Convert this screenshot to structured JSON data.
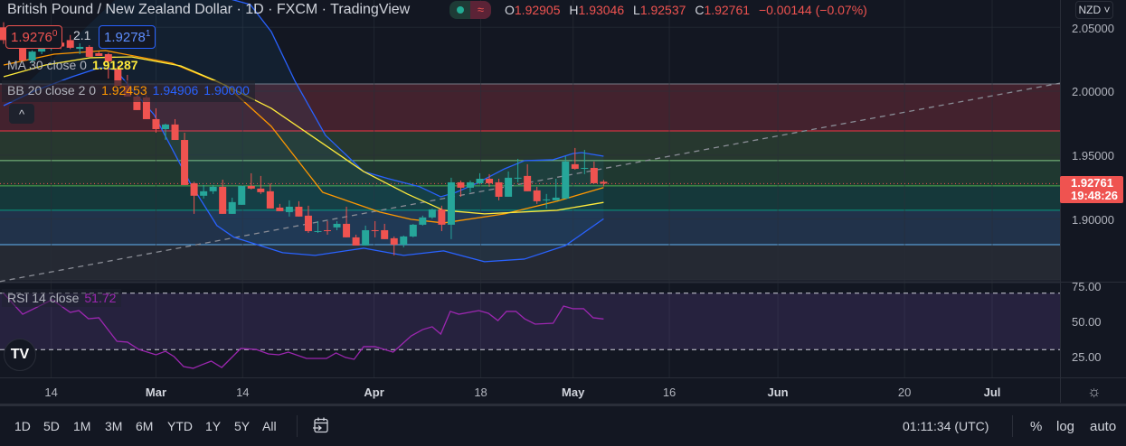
{
  "header": {
    "title": "British Pound / New Zealand Dollar · 1D · FXCM · TradingView",
    "status_symbol": "≈",
    "ohlc": {
      "o_label": "O",
      "o": "1.92905",
      "h_label": "H",
      "h": "1.93046",
      "l_label": "L",
      "l": "1.92537",
      "c_label": "C",
      "c": "1.92761",
      "change": "−0.00144 (−0.07%)"
    }
  },
  "trade": {
    "sell": "1.9276",
    "sell_sup": "0",
    "spread": "2.1",
    "buy": "1.9278",
    "buy_sup": "1"
  },
  "legends": {
    "ma": {
      "name": "MA 30 close 0",
      "value": "1.91287"
    },
    "bb": {
      "name": "BB 20 close 2 0",
      "basis": "1.92453",
      "upper": "1.94906",
      "lower": "1.90000"
    },
    "rsi": {
      "name": "RSI 14 close",
      "value": "51.72"
    }
  },
  "collapse_icon": "^",
  "logo_text": "TV",
  "price_axis": {
    "currency": "NZD",
    "ticks": [
      "2.05000",
      "2.00000",
      "1.95000",
      "1.90000"
    ],
    "rsi_ticks": [
      "75.00",
      "50.00",
      "25.00"
    ],
    "last_price": "1.92761",
    "countdown": "19:48:26"
  },
  "bottom_bar": {
    "periods": [
      "1D",
      "5D",
      "1M",
      "3M",
      "6M",
      "YTD",
      "1Y",
      "5Y",
      "All"
    ],
    "clock": "01:11:34 (UTC)",
    "percent": "%",
    "log": "log",
    "auto": "auto"
  },
  "colors": {
    "up": "#26a69a",
    "down": "#ef5350",
    "ma": "#ffeb3b",
    "bb_basis": "#ff9800",
    "bb_band": "#2962ff",
    "rsi": "#9c27b0",
    "background": "#131722"
  },
  "chart_data": {
    "type": "candlestick",
    "title": "British Pound / New Zealand Dollar · 1D · FXCM",
    "ylim": [
      1.848,
      2.07
    ],
    "yticks": [
      2.05,
      2.0,
      1.95,
      1.9
    ],
    "x_ticks": [
      {
        "label": "14",
        "bar": 5.0,
        "month": false
      },
      {
        "label": "Mar",
        "bar": 16.0,
        "month": true
      },
      {
        "label": "14",
        "bar": 25.1,
        "month": false
      },
      {
        "label": "Apr",
        "bar": 38.9,
        "month": true
      },
      {
        "label": "18",
        "bar": 50.1,
        "month": false
      },
      {
        "label": "May",
        "bar": 59.8,
        "month": true
      },
      {
        "label": "16",
        "bar": 69.9,
        "month": false
      },
      {
        "label": "Jun",
        "bar": 81.3,
        "month": true
      },
      {
        "label": "20",
        "bar": 94.6,
        "month": false
      },
      {
        "label": "Jul",
        "bar": 103.8,
        "month": true
      }
    ],
    "candles_ohlc": [
      [
        2.05,
        2.054,
        2.037,
        2.04
      ],
      [
        2.037,
        2.043,
        2.035,
        2.041
      ],
      [
        2.034,
        2.036,
        2.024,
        2.024
      ],
      [
        2.024,
        2.032,
        2.022,
        2.031
      ],
      [
        2.031,
        2.035,
        2.029,
        2.034
      ],
      [
        2.034,
        2.04,
        2.032,
        2.038
      ],
      [
        2.038,
        2.041,
        2.033,
        2.035
      ],
      [
        2.04,
        2.044,
        2.033,
        2.034
      ],
      [
        2.0332,
        2.0375,
        2.029,
        2.0347
      ],
      [
        2.0347,
        2.036,
        2.0269,
        2.0269
      ],
      [
        2.0297,
        2.031,
        2.0276,
        2.0276
      ],
      [
        2.029,
        2.03,
        2.0099,
        2.0234
      ],
      [
        2.017,
        2.02,
        2.0043,
        2.0043
      ],
      [
        2.0043,
        2.0128,
        1.9958,
        1.9958
      ],
      [
        1.9958,
        1.997,
        1.9852,
        1.9852
      ],
      [
        1.9951,
        1.997,
        1.9781,
        1.9781
      ],
      [
        1.9781,
        1.9866,
        1.9675,
        1.9703
      ],
      [
        1.9703,
        1.9746,
        1.9618,
        1.9739
      ],
      [
        1.9739,
        1.9781,
        1.9618,
        1.9618
      ],
      [
        1.9618,
        1.9675,
        1.9265,
        1.9265
      ],
      [
        1.9279,
        1.929,
        1.9039,
        1.9181
      ],
      [
        1.9181,
        1.9265,
        1.9159,
        1.9216
      ],
      [
        1.9216,
        1.9265,
        1.9195,
        1.9251
      ],
      [
        1.9251,
        1.9307,
        1.9039,
        1.9039
      ],
      [
        1.9039,
        1.9166,
        1.9039,
        1.9131
      ],
      [
        1.911,
        1.9258,
        1.911,
        1.9258
      ],
      [
        1.9258,
        1.9357,
        1.923,
        1.9237
      ],
      [
        1.9237,
        1.9336,
        1.9195,
        1.9209
      ],
      [
        1.9216,
        1.9279,
        1.9081,
        1.9081
      ],
      [
        1.9088,
        1.9117,
        1.906,
        1.906
      ],
      [
        1.9053,
        1.9145,
        1.9018,
        1.9095
      ],
      [
        1.9095,
        1.9138,
        1.9018,
        1.9018
      ],
      [
        1.9025,
        1.9103,
        1.889,
        1.8904
      ],
      [
        1.8897,
        1.8982,
        1.889,
        1.8904
      ],
      [
        1.8911,
        1.8982,
        1.8876,
        1.8904
      ],
      [
        1.8933,
        1.8982,
        1.8911,
        1.8961
      ],
      [
        1.8961,
        1.9095,
        1.8855,
        1.8855
      ],
      [
        1.8855,
        1.8876,
        1.8791,
        1.8791
      ],
      [
        1.8791,
        1.8947,
        1.8791,
        1.8911
      ],
      [
        1.8911,
        1.8982,
        1.8855,
        1.8904
      ],
      [
        1.8911,
        1.8961,
        1.8841,
        1.8841
      ],
      [
        1.8848,
        1.8862,
        1.8714,
        1.8798
      ],
      [
        1.8798,
        1.8869,
        1.8777,
        1.8862
      ],
      [
        1.8862,
        1.896,
        1.8855,
        1.8954
      ],
      [
        1.8954,
        1.9025,
        1.8947,
        1.9011
      ],
      [
        1.9011,
        1.908,
        1.9,
        1.9074
      ],
      [
        1.9074,
        1.9103,
        1.8904,
        1.8954
      ],
      [
        1.8954,
        1.9322,
        1.8841,
        1.9286
      ],
      [
        1.9286,
        1.93,
        1.9173,
        1.9244
      ],
      [
        1.9244,
        1.93,
        1.9209,
        1.9286
      ],
      [
        1.9279,
        1.9357,
        1.927,
        1.9314
      ],
      [
        1.9314,
        1.935,
        1.9251,
        1.9279
      ],
      [
        1.9286,
        1.9314,
        1.9145,
        1.9173
      ],
      [
        1.9173,
        1.9371,
        1.9173,
        1.9322
      ],
      [
        1.9318,
        1.947,
        1.9286,
        1.9322
      ],
      [
        1.9336,
        1.9428,
        1.9216,
        1.9216
      ],
      [
        1.9223,
        1.9251,
        1.9117,
        1.9138
      ],
      [
        1.9145,
        1.9195,
        1.9081,
        1.9152
      ],
      [
        1.9145,
        1.9314,
        1.9145,
        1.9166
      ],
      [
        1.9159,
        1.9491,
        1.9159,
        1.9449
      ],
      [
        1.9428,
        1.9555,
        1.9385,
        1.9392
      ],
      [
        1.9392,
        1.954,
        1.935,
        1.9399
      ],
      [
        1.9399,
        1.9449,
        1.9279,
        1.9279
      ],
      [
        1.92905,
        1.93046,
        1.92537,
        1.92761
      ]
    ],
    "ma30": [
      [
        0,
        2.0113
      ],
      [
        4.4,
        2.0205
      ],
      [
        9.1,
        2.0262
      ],
      [
        13.4,
        2.0269
      ],
      [
        18.6,
        2.0198
      ],
      [
        22.4,
        2.0078
      ],
      [
        28.1,
        1.9866
      ],
      [
        37.8,
        1.9371
      ],
      [
        42.4,
        1.9194
      ],
      [
        46.2,
        1.9067
      ],
      [
        50.5,
        1.9039
      ],
      [
        58.1,
        1.9067
      ],
      [
        63,
        1.91287
      ]
    ],
    "bb_basis": [
      [
        0,
        2.0205
      ],
      [
        5.3,
        2.029
      ],
      [
        10.7,
        2.0318
      ],
      [
        17.7,
        2.0219
      ],
      [
        23.4,
        2.0043
      ],
      [
        28.1,
        1.9725
      ],
      [
        33.5,
        1.9208
      ],
      [
        39.5,
        1.9053
      ],
      [
        42.8,
        1.8996
      ],
      [
        46.2,
        1.8968
      ],
      [
        52.6,
        1.9039
      ],
      [
        58.1,
        1.9138
      ],
      [
        63,
        1.92453
      ]
    ],
    "bb_upper": [
      [
        15,
        2.095
      ],
      [
        22.4,
        2.075
      ],
      [
        25.9,
        2.0679
      ],
      [
        28.1,
        2.0467
      ],
      [
        30.6,
        2.0078
      ],
      [
        33.8,
        1.9654
      ],
      [
        37.8,
        1.9371
      ],
      [
        40.4,
        1.9315
      ],
      [
        43.7,
        1.9251
      ],
      [
        45.9,
        1.9173
      ],
      [
        47.5,
        1.9208
      ],
      [
        49.7,
        1.9279
      ],
      [
        52.6,
        1.9392
      ],
      [
        54.7,
        1.9456
      ],
      [
        57.7,
        1.9463
      ],
      [
        59.8,
        1.9512
      ],
      [
        60.7,
        1.9519
      ],
      [
        63,
        1.94906
      ]
    ],
    "bb_lower": [
      [
        0,
        1.9887
      ],
      [
        3.4,
        2.0007
      ],
      [
        7.2,
        2.0113
      ],
      [
        10.1,
        2.0184
      ],
      [
        11.7,
        2.017
      ],
      [
        15.8,
        1.9816
      ],
      [
        19.6,
        1.9279
      ],
      [
        22.4,
        1.8947
      ],
      [
        24.2,
        1.8855
      ],
      [
        29.3,
        1.8735
      ],
      [
        32.7,
        1.8714
      ],
      [
        37.8,
        1.877
      ],
      [
        42,
        1.8714
      ],
      [
        46.2,
        1.8749
      ],
      [
        50.5,
        1.8664
      ],
      [
        54.7,
        1.8685
      ],
      [
        59,
        1.8791
      ],
      [
        63,
        1.9
      ]
    ],
    "zones": [
      {
        "from": 2.0057,
        "to": 1.9689,
        "fill": "#43222e",
        "line": "#787b86"
      },
      {
        "from": 1.9689,
        "to": 1.9456,
        "fill": "#27382f",
        "line": "#f23645"
      },
      {
        "from": 1.9456,
        "to": 1.9258,
        "fill": "#1f3830",
        "line": "#81c784"
      },
      {
        "from": 1.9258,
        "to": 1.9067,
        "fill": "#15383a",
        "line": "#4caf50"
      },
      {
        "from": 1.9067,
        "to": 1.8798,
        "fill": "#21324a",
        "line": "#089981"
      },
      {
        "from": 1.8798,
        "to": 1.8522,
        "fill": "#252933",
        "line": "#64b5f6"
      }
    ],
    "trendline": [
      [
        -0.4,
        1.8509
      ],
      [
        111,
        2.0064
      ]
    ],
    "rsi": {
      "ylim": [
        0,
        100
      ],
      "upper_band": 70,
      "lower_band": 30,
      "values": [
        [
          0,
          69.9
        ],
        [
          2,
          55.1
        ],
        [
          5.1,
          65.4
        ],
        [
          7,
          56.4
        ],
        [
          7.9,
          57.7
        ],
        [
          8.9,
          51.9
        ],
        [
          10,
          52.6
        ],
        [
          11.9,
          35.9
        ],
        [
          13,
          35.3
        ],
        [
          14.2,
          30.1
        ],
        [
          16,
          26.3
        ],
        [
          17,
          28.8
        ],
        [
          17.9,
          25
        ],
        [
          18.9,
          17.9
        ],
        [
          19.9,
          16.7
        ],
        [
          20.8,
          19.2
        ],
        [
          21.8,
          21.8
        ],
        [
          22.9,
          17.3
        ],
        [
          24.9,
          30.8
        ],
        [
          26.5,
          30.1
        ],
        [
          27.8,
          26.9
        ],
        [
          28.9,
          26.3
        ],
        [
          29.9,
          28.2
        ],
        [
          31.8,
          23.7
        ],
        [
          33.9,
          23.7
        ],
        [
          34.9,
          27.6
        ],
        [
          35.9,
          24.4
        ],
        [
          36.8,
          23.1
        ],
        [
          37.8,
          32.1
        ],
        [
          39,
          32.1
        ],
        [
          40.9,
          28.2
        ],
        [
          42.8,
          39.7
        ],
        [
          44,
          44.2
        ],
        [
          45,
          46.2
        ],
        [
          45.9,
          41
        ],
        [
          46.9,
          57.1
        ],
        [
          47.8,
          55.1
        ],
        [
          49.9,
          57.7
        ],
        [
          50.9,
          55.8
        ],
        [
          51.9,
          50.6
        ],
        [
          52.8,
          57.1
        ],
        [
          53.8,
          57.1
        ],
        [
          54.7,
          51.9
        ],
        [
          55.8,
          48.1
        ],
        [
          57.7,
          48.7
        ],
        [
          58.8,
          60.9
        ],
        [
          59.8,
          59
        ],
        [
          60.9,
          59
        ],
        [
          61.9,
          52.6
        ],
        [
          63,
          51.72
        ]
      ]
    }
  }
}
